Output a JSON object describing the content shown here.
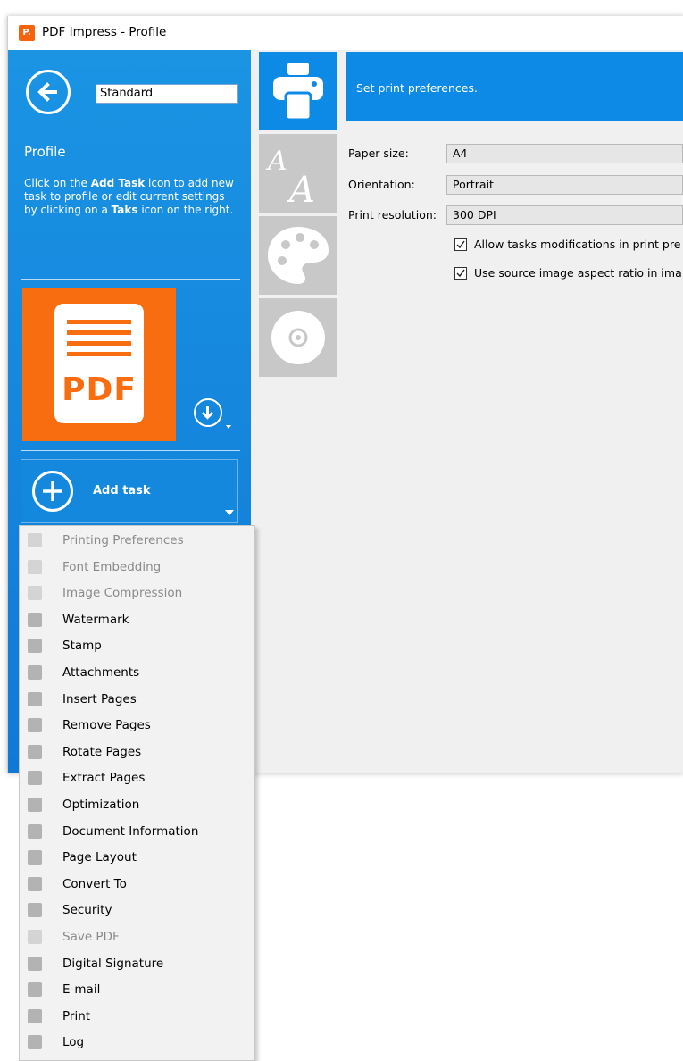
{
  "window": {
    "title": "PDF Impress - Profile"
  },
  "sidebar": {
    "profile_name": "Standard",
    "heading": "Profile",
    "help": {
      "p1": "Click on the ",
      "b1": "Add Task",
      "p2": " icon to add new task to profile or edit current settings by clicking on a ",
      "b2": "Taks",
      "p3": " icon on the right."
    },
    "output_format": "PDF",
    "add_task_label": "Add task"
  },
  "content": {
    "header_text": "Set print preferences.",
    "paper_size": {
      "label": "Paper size:",
      "value": "A4"
    },
    "orientation": {
      "label": "Orientation:",
      "value": "Portrait"
    },
    "print_resolution": {
      "label": "Print resolution:",
      "value": "300 DPI"
    },
    "checkbox1": {
      "label": "Allow tasks modifications in print pre",
      "checked": true
    },
    "checkbox2": {
      "label": "Use source image aspect ratio in ima",
      "checked": true
    }
  },
  "menu": {
    "items": [
      {
        "label": "Printing Preferences",
        "disabled": true
      },
      {
        "label": "Font Embedding",
        "disabled": true
      },
      {
        "label": "Image Compression",
        "disabled": true
      },
      {
        "label": "Watermark",
        "disabled": false
      },
      {
        "label": "Stamp",
        "disabled": false
      },
      {
        "label": "Attachments",
        "disabled": false
      },
      {
        "label": "Insert Pages",
        "disabled": false
      },
      {
        "label": "Remove Pages",
        "disabled": false
      },
      {
        "label": "Rotate Pages",
        "disabled": false
      },
      {
        "label": "Extract Pages",
        "disabled": false
      },
      {
        "label": "Optimization",
        "disabled": false
      },
      {
        "label": "Document Information",
        "disabled": false
      },
      {
        "label": "Page Layout",
        "disabled": false
      },
      {
        "label": "Convert To",
        "disabled": false
      },
      {
        "label": "Security",
        "disabled": false
      },
      {
        "label": "Save PDF",
        "disabled": true
      },
      {
        "label": "Digital Signature",
        "disabled": false
      },
      {
        "label": "E-mail",
        "disabled": false
      },
      {
        "label": "Print",
        "disabled": false
      },
      {
        "label": "Log",
        "disabled": false
      }
    ]
  },
  "colors": {
    "accent": "#0d8ae6",
    "pdf_orange": "#f86d0f",
    "tile_gray": "#c8c8c8"
  }
}
